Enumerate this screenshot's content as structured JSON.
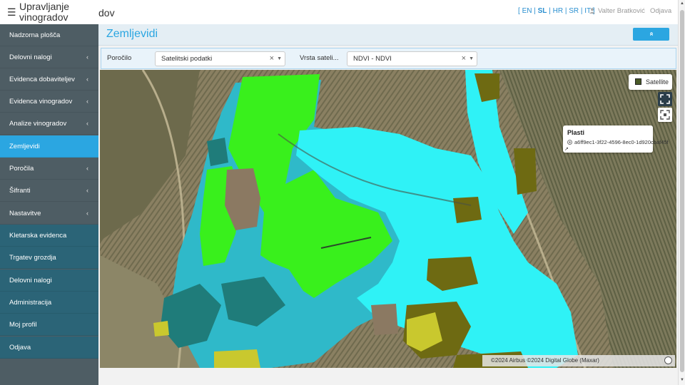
{
  "header": {
    "menu_icon": "hamburger-icon",
    "app_title": "Upravljanje vinogradov",
    "title_spill": "dov",
    "languages": [
      "EN",
      "SL",
      "HR",
      "SR",
      "IT"
    ],
    "active_language": "SL",
    "bracket_open": "[",
    "bracket_close": "]",
    "user_name": "Valter Bratković",
    "logout": "Odjava"
  },
  "sidebar": {
    "items": [
      {
        "label": "Nadzorna plošča",
        "chevron": ""
      },
      {
        "label": "Delovni nalogi",
        "chevron": "‹"
      },
      {
        "label": "Evidenca dobaviteljev",
        "chevron": "‹"
      },
      {
        "label": "Evidenca vinogradov",
        "chevron": "‹"
      },
      {
        "label": "Analize vinogradov",
        "chevron": "‹"
      },
      {
        "label": "Zemljevidi",
        "chevron": ""
      },
      {
        "label": "Poročila",
        "chevron": "‹"
      },
      {
        "label": "Šifranti",
        "chevron": "‹"
      },
      {
        "label": "Nastavitve",
        "chevron": "‹"
      },
      {
        "label": "Kletarska evidenca",
        "chevron": ""
      },
      {
        "label": "Trgatev grozdja",
        "chevron": ""
      },
      {
        "label": "Delovni nalogi",
        "chevron": ""
      },
      {
        "label": "Administracija",
        "chevron": ""
      },
      {
        "label": "Moj profil",
        "chevron": ""
      },
      {
        "label": "Odjava",
        "chevron": ""
      }
    ],
    "active_item": "Zemljevidi"
  },
  "page": {
    "title": "Zemljevidi",
    "collapse_icon": "chevron-up-double-icon",
    "collapse_symbol": "«"
  },
  "filters": {
    "report_label": "Poročilo",
    "report_value": "Satelitski podatki",
    "type_label": "Vrsta sateli...",
    "type_value": "NDVI - NDVI",
    "clear_symbol": "×",
    "arrow_symbol": "▼"
  },
  "map": {
    "layer_button": "Satellite",
    "legend_title": "Plasti",
    "legend_item": "a6ff9ec1-3f22-4596-8ec0-1d920cbaf45f",
    "attribution": "©2024 Airbus ©2024 Digital Globe (Maxar)",
    "ndvi_colors": {
      "bright_green": "#39f01c",
      "cyan": "#2ff2f6",
      "teal": "#2fb9c9",
      "dark_teal": "#1f7c7a",
      "olive": "#6e6a12",
      "yellow": "#c9c82e"
    }
  },
  "colors": {
    "accent": "#2ba6e1",
    "sidebar_bg": "#4e5d64",
    "sidebar_dark": "#2b6477"
  }
}
